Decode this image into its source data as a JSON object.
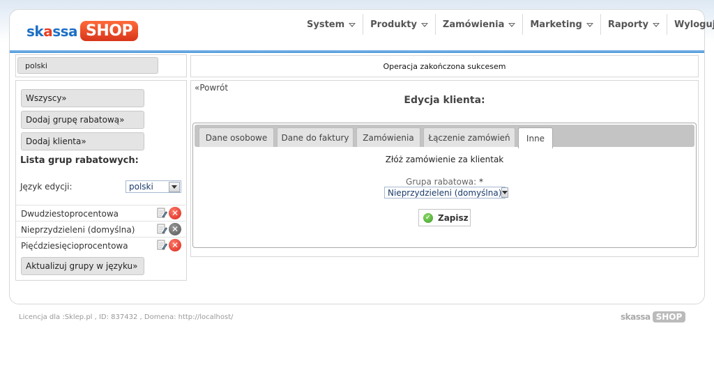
{
  "logo": {
    "part1": "sk",
    "part2": "a",
    "part3": "ssa",
    "shop": "SHOP"
  },
  "nav": {
    "items": [
      {
        "label": "System",
        "dropdown": true
      },
      {
        "label": "Produkty",
        "dropdown": true
      },
      {
        "label": "Zamówienia",
        "dropdown": true
      },
      {
        "label": "Marketing",
        "dropdown": true
      },
      {
        "label": "Raporty",
        "dropdown": true
      },
      {
        "label": "Wyloguj",
        "dropdown": false
      }
    ]
  },
  "sidebar": {
    "language": "polski",
    "buttons": {
      "all": "Wszyscy»",
      "add_group": "Dodaj grupę rabatową»",
      "add_client": "Dodaj klienta»",
      "update": "Aktualizuj grupy w języku»"
    },
    "list_title": "Lista grup rabatowych:",
    "edit_lang_label": "Język edycji:",
    "edit_lang_value": "polski",
    "groups": [
      {
        "name": "Dwudziestoprocentowa",
        "delete_color": "red"
      },
      {
        "name": "Nieprzydzieleni (domyślna)",
        "delete_color": "grey"
      },
      {
        "name": "Pięćdziesięcioprocentowa",
        "delete_color": "red"
      }
    ]
  },
  "main": {
    "notice": "Operacja zakończona sukcesem",
    "back": "«Powrót",
    "title": "Edycja klienta:",
    "tabs": [
      {
        "label": "Dane osobowe",
        "active": false
      },
      {
        "label": "Dane do faktury",
        "active": false
      },
      {
        "label": "Zamówienia",
        "active": false
      },
      {
        "label": "Łączenie zamówień",
        "active": false
      },
      {
        "label": "Inne",
        "active": true
      }
    ],
    "order_text": "Złóż zamówienie za klientak",
    "rabat_label": "Grupa rabatowa:",
    "required_mark": "*",
    "rabat_value": "Nieprzydzieleni (domyślna)",
    "save": "Zapisz"
  },
  "footer": {
    "license": "Licencja dla :Sklep.pl , ID: 837432 , Domena: http://localhost/",
    "logo_main": "skassa",
    "logo_shop": "SHOP"
  },
  "colors": {
    "accent_blue": "#3f8fd8",
    "logo_blue": "#1c6fc5",
    "logo_orange": "#e83e23",
    "delete_red": "#d8261a",
    "ok_green": "#3a9a24"
  }
}
